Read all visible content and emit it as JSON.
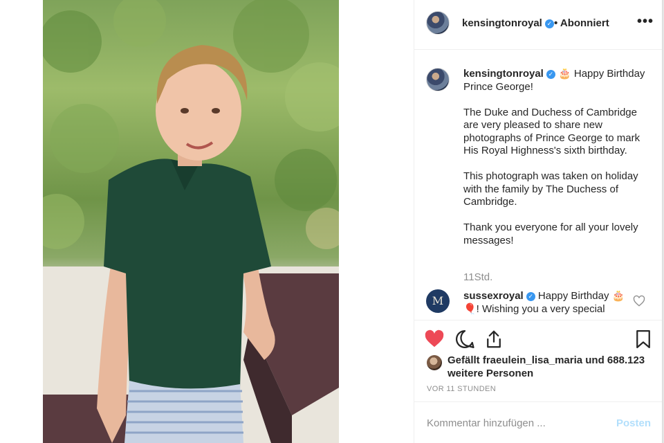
{
  "header": {
    "username": "kensingtonroyal",
    "follow_status": "• Abonniert",
    "more_label": "•••"
  },
  "caption": {
    "username": "kensingtonroyal",
    "first_line": "🎂 Happy Birthday Prince George!",
    "paragraphs": [
      "The Duke and Duchess of Cambridge are very pleased to share new photographs of Prince George to mark His Royal Highness's sixth birthday.",
      "This photograph was taken on holiday with the family by The Duchess of Cambridge.",
      "Thank you everyone for all your lovely messages!"
    ],
    "time": "11Std."
  },
  "comment": {
    "username": "sussexroyal",
    "text": "Happy Birthday 🎂🎈! Wishing you a very special",
    "avatar_letter": "M"
  },
  "likes": {
    "text": "Gefällt fraeulein_lisa_maria und 688.123 weitere Personen"
  },
  "timestamp": "VOR 11 STUNDEN",
  "add_comment": {
    "placeholder": "Kommentar hinzufügen ...",
    "post_label": "Posten"
  },
  "colors": {
    "accent_blue": "#3897f0",
    "like_red": "#ed4956",
    "post_disabled": "#b2dffc"
  },
  "icons": {
    "verified": "verified-badge-icon",
    "like": "heart-filled-icon",
    "comment": "comment-bubble-icon",
    "share": "share-icon",
    "save": "bookmark-icon"
  }
}
